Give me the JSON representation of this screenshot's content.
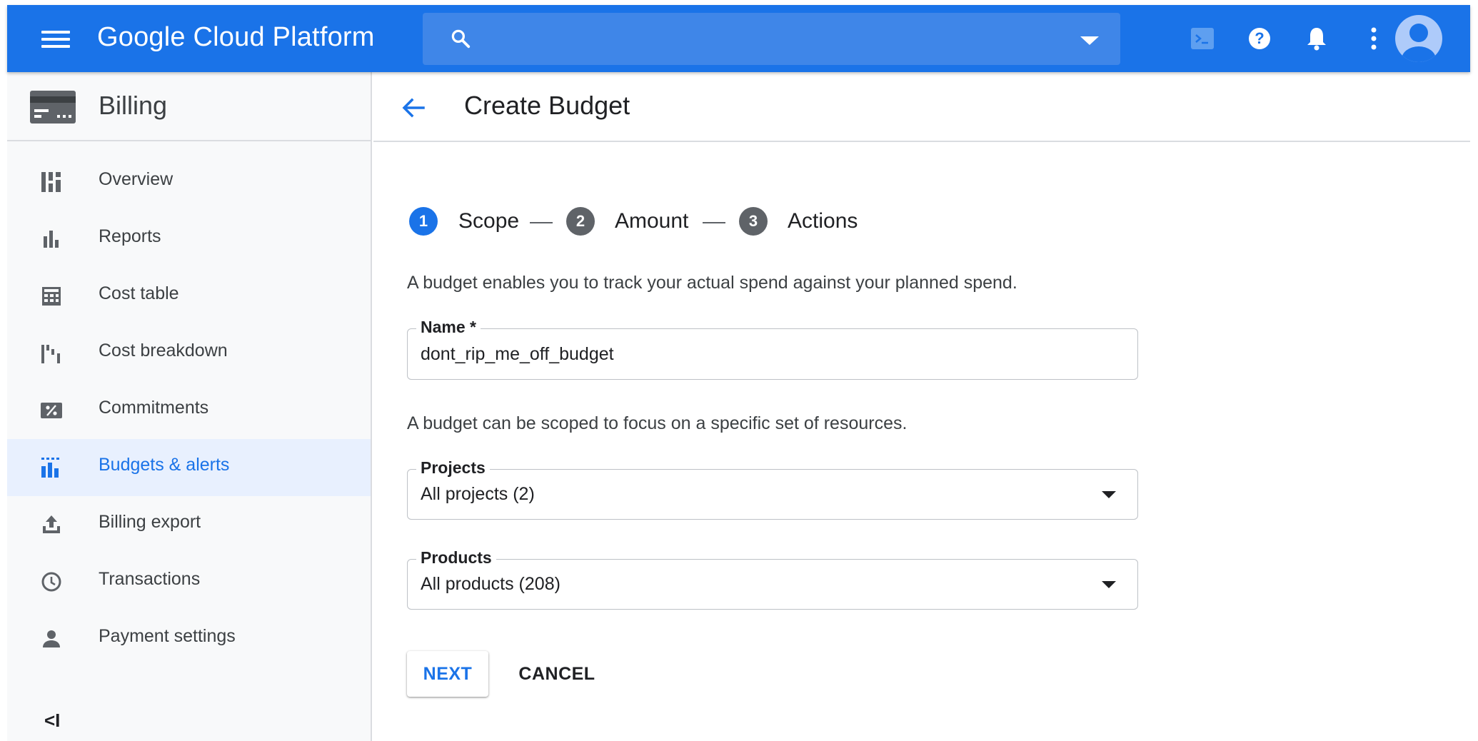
{
  "topbar": {
    "brand": "Google Cloud Platform",
    "search_placeholder": "",
    "icons": [
      "menu-icon",
      "search-icon",
      "dropdown-caret-icon",
      "cloud-shell-icon",
      "help-icon",
      "notifications-icon",
      "more-vert-icon",
      "account-avatar-icon"
    ]
  },
  "sidebar": {
    "title": "Billing",
    "items": [
      {
        "label": "Overview",
        "icon": "dashboard-icon"
      },
      {
        "label": "Reports",
        "icon": "bar-chart-icon"
      },
      {
        "label": "Cost table",
        "icon": "table-icon"
      },
      {
        "label": "Cost breakdown",
        "icon": "waterfall-icon"
      },
      {
        "label": "Commitments",
        "icon": "percent-icon"
      },
      {
        "label": "Budgets & alerts",
        "icon": "budget-icon",
        "active": true
      },
      {
        "label": "Billing export",
        "icon": "upload-icon"
      },
      {
        "label": "Transactions",
        "icon": "clock-icon"
      },
      {
        "label": "Payment settings",
        "icon": "person-icon"
      }
    ],
    "collapse_label": "<I"
  },
  "main": {
    "title": "Create Budget",
    "steps": [
      {
        "number": "1",
        "label": "Scope",
        "active": true
      },
      {
        "number": "2",
        "label": "Amount",
        "active": false
      },
      {
        "number": "3",
        "label": "Actions",
        "active": false
      }
    ],
    "intro": "A budget enables you to track your actual spend against your planned spend.",
    "name_field": {
      "label": "Name *",
      "value": "dont_rip_me_off_budget"
    },
    "scope_text": "A budget can be scoped to focus on a specific set of resources.",
    "projects_field": {
      "label": "Projects",
      "value": "All projects (2)"
    },
    "products_field": {
      "label": "Products",
      "value": "All products (208)"
    },
    "next_label": "NEXT",
    "cancel_label": "CANCEL"
  },
  "colors": {
    "brand_blue": "#1a73e8",
    "search_bg": "#3f86e8",
    "active_nav_bg": "#e8f0fe",
    "step_inactive": "#5f6368"
  }
}
